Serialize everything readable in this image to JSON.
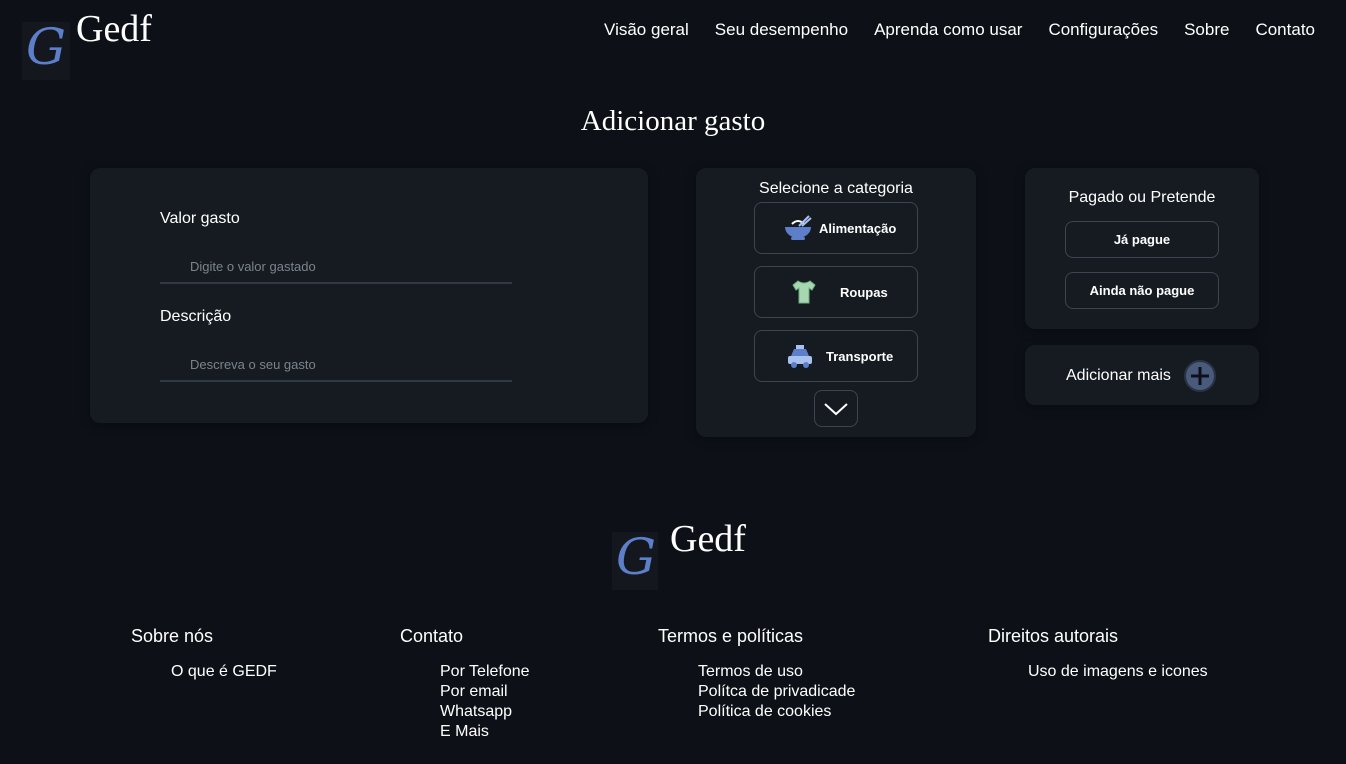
{
  "brand": {
    "mark": "G",
    "name": "Gedf"
  },
  "nav": {
    "items": [
      "Visão geral",
      "Seu desempenho",
      "Aprenda como usar",
      "Configurações",
      "Sobre",
      "Contato"
    ]
  },
  "page_title": "Adicionar gasto",
  "form": {
    "value_label": "Valor gasto",
    "value_placeholder": "Digite o valor gastado",
    "desc_label": "Descrição",
    "desc_placeholder": "Descreva o seu gasto"
  },
  "category": {
    "title": "Selecione a categoria",
    "items": [
      {
        "label": "Alimentação",
        "icon": "food-bowl-icon"
      },
      {
        "label": "Roupas",
        "icon": "shirt-icon"
      },
      {
        "label": "Transporte",
        "icon": "car-icon"
      }
    ],
    "more_icon": "chevron-down-icon"
  },
  "payment": {
    "title": "Pagado ou Pretende",
    "paid": "Já pague",
    "not_paid": "Ainda não pague"
  },
  "add_more": {
    "label": "Adicionar mais",
    "icon": "plus-circle-icon"
  },
  "footer": {
    "columns": [
      {
        "title": "Sobre nós",
        "links": [
          "O que é GEDF"
        ]
      },
      {
        "title": "Contato",
        "links": [
          "Por Telefone",
          "Por email",
          "Whatsapp",
          "E Mais"
        ]
      },
      {
        "title": "Termos e políticas",
        "links": [
          "Termos de uso",
          "Polítca de privadicade",
          "Política de cookies"
        ]
      },
      {
        "title": "Direitos autorais",
        "links": [
          "Uso de imagens e icones"
        ]
      }
    ]
  },
  "colors": {
    "background": "#0d1117",
    "card": "#161b22",
    "accent_blue": "#5d7ec9",
    "border": "#3b4450"
  }
}
